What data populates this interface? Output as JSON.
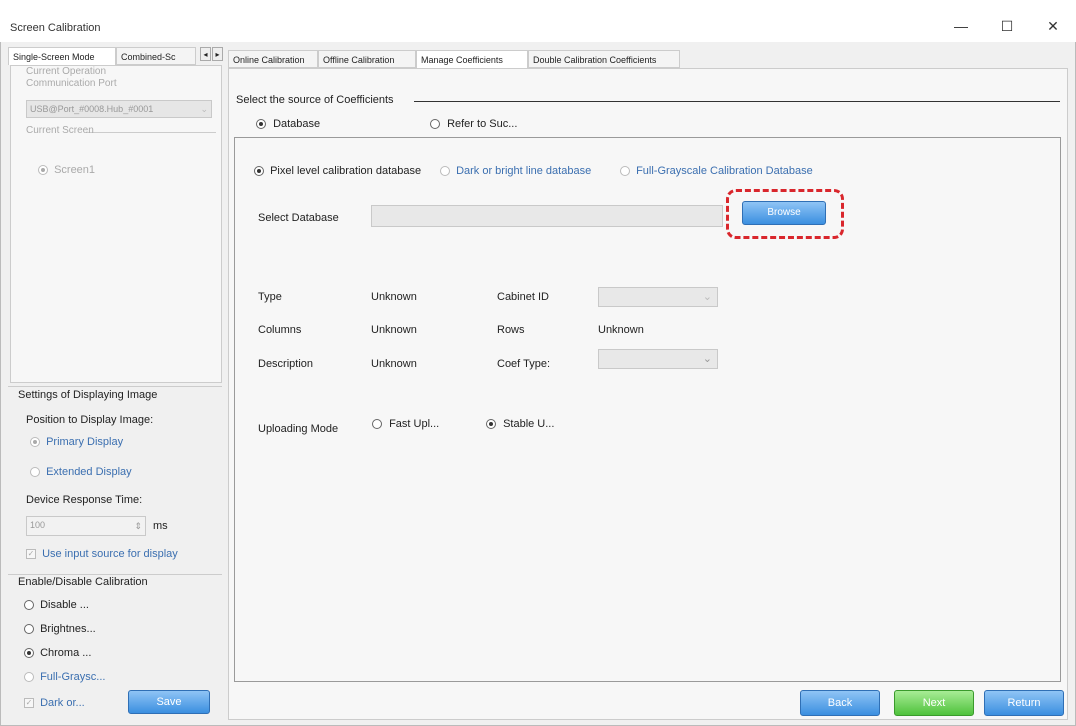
{
  "window": {
    "title": "Screen Calibration",
    "min": "—",
    "max": "☐",
    "close": "✕"
  },
  "left_tabs": {
    "tab1": "Single-Screen Mode",
    "tab2": "Combined-Sc",
    "prev": "◂",
    "next": "▸"
  },
  "left_panel": {
    "op_label_1": "Current Operation",
    "op_label_2": "Communication Port",
    "port_value": "USB@Port_#0008.Hub_#0001",
    "screen_group": "Current Screen",
    "screen_item": "Screen1"
  },
  "display_settings": {
    "title": "Settings of Displaying Image",
    "position_label": "Position to Display Image:",
    "primary": "Primary Display",
    "extended": "Extended Display",
    "response_label": "Device Response Time:",
    "response_value": "100",
    "response_unit": "ms",
    "use_input": "Use input source for display"
  },
  "calibration_toggle": {
    "title": "Enable/Disable Calibration",
    "disable": "Disable ...",
    "brightness": "Brightnes...",
    "chroma": "Chroma ...",
    "full_grayscale": "Full-Graysc...",
    "dark_or": "Dark or...",
    "save": "Save"
  },
  "right_tabs": [
    "Online Calibration",
    "Offline Calibration",
    "Manage Coefficients",
    "Double Calibration Coefficients"
  ],
  "source": {
    "title": "Select the source of Coefficients",
    "database": "Database",
    "refer": "Refer to Suc..."
  },
  "db_types": {
    "pixel": "Pixel level calibration database",
    "dark_bright": "Dark or bright line database",
    "full_grayscale": "Full-Grayscale Calibration Database"
  },
  "select_db": {
    "label": "Select Database",
    "value": "",
    "browse": "Browse"
  },
  "info": {
    "type_label": "Type",
    "type_value": "Unknown",
    "cabinet_label": "Cabinet ID",
    "columns_label": "Columns",
    "columns_value": "Unknown",
    "rows_label": "Rows",
    "rows_value": "Unknown",
    "desc_label": "Description",
    "desc_value": "Unknown",
    "coef_label": "Coef Type:"
  },
  "upload": {
    "label": "Uploading Mode",
    "fast": "Fast Upl...",
    "stable": "Stable U..."
  },
  "footer": {
    "back": "Back",
    "next": "Next",
    "return": "Return"
  },
  "colors": {
    "highlight": "#d9262c",
    "accent": "#3b8fe0",
    "next_green": "#4fc23c"
  }
}
